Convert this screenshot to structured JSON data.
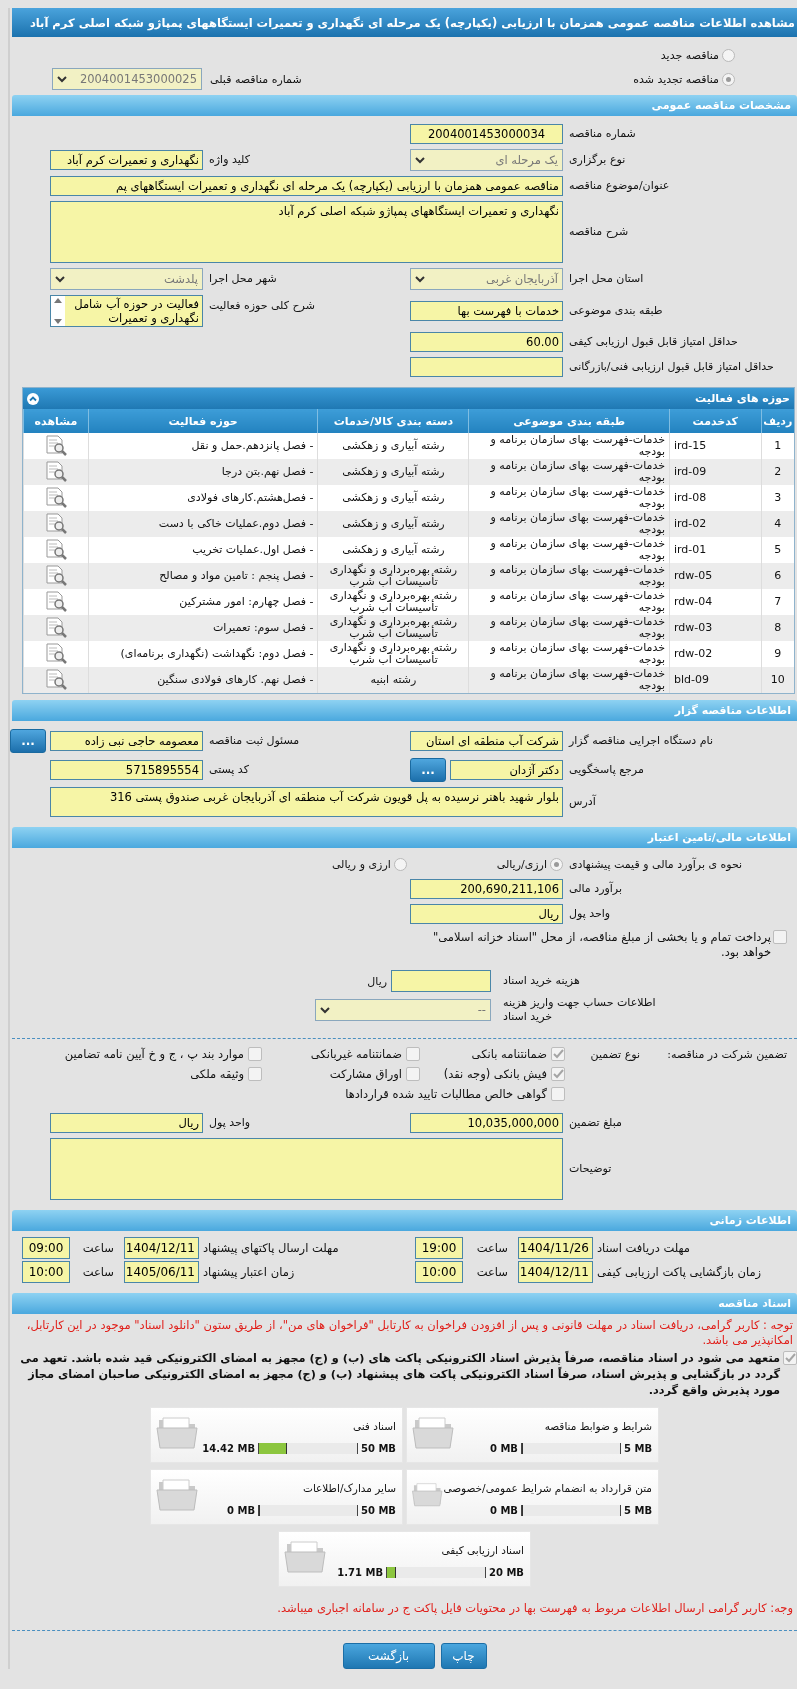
{
  "window": {
    "title": "مشاهده اطلاعات مناقصه عمومی همزمان با ارزیابی (یکپارچه) یک مرحله ای نگهداری و تعمیرات ایستگاههای پمپاژو شبکه اصلی کرم آباد"
  },
  "tender_type": {
    "options": [
      {
        "label": "مناقصه جدید",
        "selected": false
      },
      {
        "label": "مناقصه تجدید شده",
        "selected": true
      }
    ],
    "previous_label": "شماره مناقصه قبلی",
    "previous_number": "2004001453000025"
  },
  "general": {
    "title": "مشخصات مناقصه عمومی",
    "rows": [
      [
        {
          "label": "شماره مناقصه",
          "value": "2004001453000034",
          "kind": "code"
        }
      ],
      [
        {
          "label": "نوع برگزاری",
          "value": "یک مرحله ای",
          "kind": "select"
        },
        {
          "label": "کلید واژه",
          "value": "نگهداری و تعمیرات کرم آباد",
          "kind": "text"
        }
      ],
      [
        {
          "label": "عنوان/موضوع مناقصه",
          "value": "مناقصه عمومی همزمان با ارزیابی (یکپارچه) یک مرحله ای نگهداری و تعمیرات ایستگاههای پم",
          "kind": "long_text"
        }
      ],
      [
        {
          "label": "شرح مناقصه",
          "value": "نگهداری و تعمیرات ایستگاههای پمپاژو شبکه اصلی کرم آباد",
          "kind": "textarea"
        }
      ],
      [
        {
          "label": "استان محل اجرا",
          "value": "آذربایجان غربی",
          "kind": "select"
        },
        {
          "label": "شهر محل اجرا",
          "value": "پلدشت",
          "kind": "select"
        }
      ],
      [
        {
          "label": "طبقه بندی موضوعی",
          "value": "خدمات با فهرست بها",
          "kind": "text"
        },
        {
          "label": "شرح کلی حوزه فعالیت",
          "value": "فعالیت در حوزه آب شامل نگهداری و تعمیرات",
          "kind": "listbox"
        }
      ],
      [
        {
          "label": "حداقل امتیاز قابل قبول ارزیابی کیفی",
          "value": "60.00",
          "kind": "text"
        }
      ],
      [
        {
          "label": "حداقل امتیاز قابل قبول ارزیابی فنی/بازرگانی",
          "kind": "text"
        }
      ]
    ]
  },
  "activities": {
    "title": "حوزه های فعالیت",
    "columns": [
      "ردیف",
      "کدخدمت",
      "طبقه بندی موضوعی",
      "دسته بندی کالا/خدمات",
      "حوزه فعالیت",
      "مشاهده"
    ],
    "rows": [
      [
        "1",
        "ird-15",
        "خدمات-فهرست بهای سازمان برنامه و بودجه",
        "رشته آبیاری و زهکشی",
        "- فصل پانزدهم.حمل و نقل"
      ],
      [
        "2",
        "ird-09",
        "خدمات-فهرست بهای سازمان برنامه و بودجه",
        "رشته آبیاری و زهکشی",
        "- فصل نهم.بتن درجا"
      ],
      [
        "3",
        "ird-08",
        "خدمات-فهرست بهای سازمان برنامه و بودجه",
        "رشته آبیاری و زهکشی",
        "- فصل‌هشتم.کارهای فولادی"
      ],
      [
        "4",
        "ird-02",
        "خدمات-فهرست بهای سازمان برنامه و بودجه",
        "رشته آبیاری و زهکشی",
        "- فصل دوم.عملیات خاکی با دست"
      ],
      [
        "5",
        "ird-01",
        "خدمات-فهرست بهای سازمان برنامه و بودجه",
        "رشته آبیاری و زهکشی",
        "- فصل اول.عملیات تخریب"
      ],
      [
        "6",
        "rdw-05",
        "خدمات-فهرست بهای سازمان برنامه و بودجه",
        "رشته بهره‌برداری و نگهداری تأسیسات آب شرب",
        "- فصل پنجم : تامین مواد و مصالح"
      ],
      [
        "7",
        "rdw-04",
        "خدمات-فهرست بهای سازمان برنامه و بودجه",
        "رشته بهره‌برداری و نگهداری تأسیسات آب شرب",
        "- فصل چهارم: امور مشترکین"
      ],
      [
        "8",
        "rdw-03",
        "خدمات-فهرست بهای سازمان برنامه و بودجه",
        "رشته بهره‌برداری و نگهداری تأسیسات آب شرب",
        "- فصل سوم: تعمیرات"
      ],
      [
        "9",
        "rdw-02",
        "خدمات-فهرست بهای سازمان برنامه و بودجه",
        "رشته بهره‌برداری و نگهداری تأسیسات آب شرب",
        "- فصل دوم: نگهداشت (نگهداری برنامه‌ای)"
      ],
      [
        "10",
        "bld-09",
        "خدمات-فهرست بهای سازمان برنامه و بودجه",
        "رشته ابنیه",
        "- فصل نهم. کارهای فولادی سنگین"
      ]
    ]
  },
  "tenderer": {
    "title": "اطلاعات مناقصه گزار",
    "rows": [
      [
        {
          "label": "نام دستگاه اجرایی مناقصه گزار",
          "value": "شرکت آب منطقه ای استان",
          "kind": "text"
        },
        {
          "label": "مسئول ثبت مناقصه",
          "value": "معصومه حاجی نبی زاده",
          "kind": "text",
          "button": "..."
        }
      ],
      [
        {
          "label": "مرجع پاسخگویی",
          "value": "دکتر آژدان",
          "kind": "text",
          "button": "..."
        },
        {
          "label": "کد پستی",
          "value": "5715895554",
          "kind": "text"
        }
      ],
      [
        {
          "label": "آدرس",
          "value": "بلوار شهید باهنر نرسیده به پل قویون شرکت آب منطقه ای آذربایجان غربی صندوق پستی 316",
          "kind": "memo"
        }
      ]
    ]
  },
  "financial": {
    "title": "اطلاعات مالی/تامین اعتبار",
    "method_label": "نحوه ی برآورد مالی و قیمت پیشنهادی",
    "methods": [
      {
        "label": "ارزی/ریالی",
        "selected": true
      },
      {
        "label": "ارزی و ریالی",
        "selected": false
      }
    ],
    "rows": [
      [
        {
          "label": "برآورد مالی",
          "value": "200,690,211,106",
          "kind": "text"
        }
      ],
      [
        {
          "label": "واحد پول",
          "value": "ریال",
          "kind": "text"
        }
      ]
    ],
    "treasury": {
      "label": "پرداخت تمام و یا بخشی از مبلغ مناقصه، از محل \"اسناد خزانه اسلامی\" خواهد بود.",
      "checked": false
    },
    "document_fee": {
      "label": "هزینه خرید اسناد",
      "unit": "ریال"
    },
    "account": {
      "label": "اطلاعات حساب جهت واریز هزینه خرید اسناد",
      "value": "--"
    }
  },
  "guarantee": {
    "title": "تضمین شرکت در مناقصه:",
    "type_label": "نوع تضمین",
    "options": [
      {
        "label": "ضمانتنامه بانکی",
        "checked": true
      },
      {
        "label": "ضمانتنامه غیربانکی",
        "checked": false
      },
      {
        "label": "موارد بند پ ، ج و خ آیین نامه تضامین",
        "checked": false
      },
      {
        "label": "فیش بانکی (وجه نقد)",
        "checked": true
      },
      {
        "label": "اوراق مشارکت",
        "checked": false
      },
      {
        "label": "وثیقه ملکی",
        "checked": false
      },
      {
        "label": "گواهی خالص مطالبات تایید شده قراردادها",
        "checked": false
      }
    ],
    "rows": [
      [
        {
          "label": "مبلغ تضمین",
          "value": "10,035,000,000",
          "kind": "text"
        },
        {
          "label": "واحد پول",
          "value": "ریال",
          "kind": "text"
        }
      ],
      [
        {
          "label": "توضیحات",
          "kind": "textarea"
        }
      ]
    ]
  },
  "schedule": {
    "title": "اطلاعات زمانی",
    "entries": [
      {
        "label": "مهلت دریافت اسناد",
        "date": "1404/11/26",
        "time_label": "ساعت",
        "time": "19:00"
      },
      {
        "label": "مهلت ارسال پاکتهای پیشنهاد",
        "date": "1404/12/11",
        "time_label": "ساعت",
        "time": "09:00"
      },
      {
        "label": "زمان بازگشایی پاکت ارزیابی کیفی",
        "date": "1404/12/11",
        "time_label": "ساعت",
        "time": "10:00"
      },
      {
        "label": "زمان اعتبار پیشنهاد",
        "date": "1405/06/11",
        "time_label": "ساعت",
        "time": "10:00"
      }
    ]
  },
  "documents": {
    "title": "اسناد مناقصه",
    "notice": "توجه : کاربر گرامی، دریافت اسناد در مهلت قانونی و پس از افزودن فراخوان به کارتابل \"فراخوان های من\"، از طریق ستون \"دانلود اسناد\" موجود در این کارتابل، امکانپذیر می باشد.",
    "commitment": {
      "label": "متعهد می شود در اسناد مناقصه، صرفاً پذیرش اسناد الکترونیکی پاکت های (ب) و (ج) مجهز به امضای الکترونیکی قید شده باشد. تعهد می گردد در بازگشایی و پذیرش اسناد، صرفاً اسناد الکترونیکی پاکت های پیشنهاد (ب) و (ج) مجهز به امضای الکترونیکی صاحبان امضای مجاز مورد پذیرش واقع گردد.",
      "checked": true
    },
    "files": [
      {
        "name": "شرایط و ضوابط مناقصه",
        "max": "5 MB",
        "used": "0 MB",
        "level": 0
      },
      {
        "name": "اسناد فنی",
        "max": "50 MB",
        "used": "14.42 MB",
        "level": 0.29
      },
      {
        "name": "متن قرارداد به انضمام شرایط عمومی/خصوصی",
        "max": "5 MB",
        "used": "0 MB",
        "level": 0
      },
      {
        "name": "سایر مدارک/اطلاعات",
        "max": "50 MB",
        "used": "0 MB",
        "level": 0
      },
      {
        "name": "اسناد ارزیابی کیفی",
        "max": "20 MB",
        "used": "1.71 MB",
        "level": 0.09
      }
    ],
    "footer_notice": "وجه: کاربر گرامی ارسال اطلاعات مربوط به فهرست بها در محتویات فایل پاکت ج در سامانه اجباری میباشد."
  },
  "buttons": [
    {
      "label": "چاپ",
      "kind": "print"
    },
    {
      "label": "بازگشت",
      "kind": "back"
    }
  ]
}
